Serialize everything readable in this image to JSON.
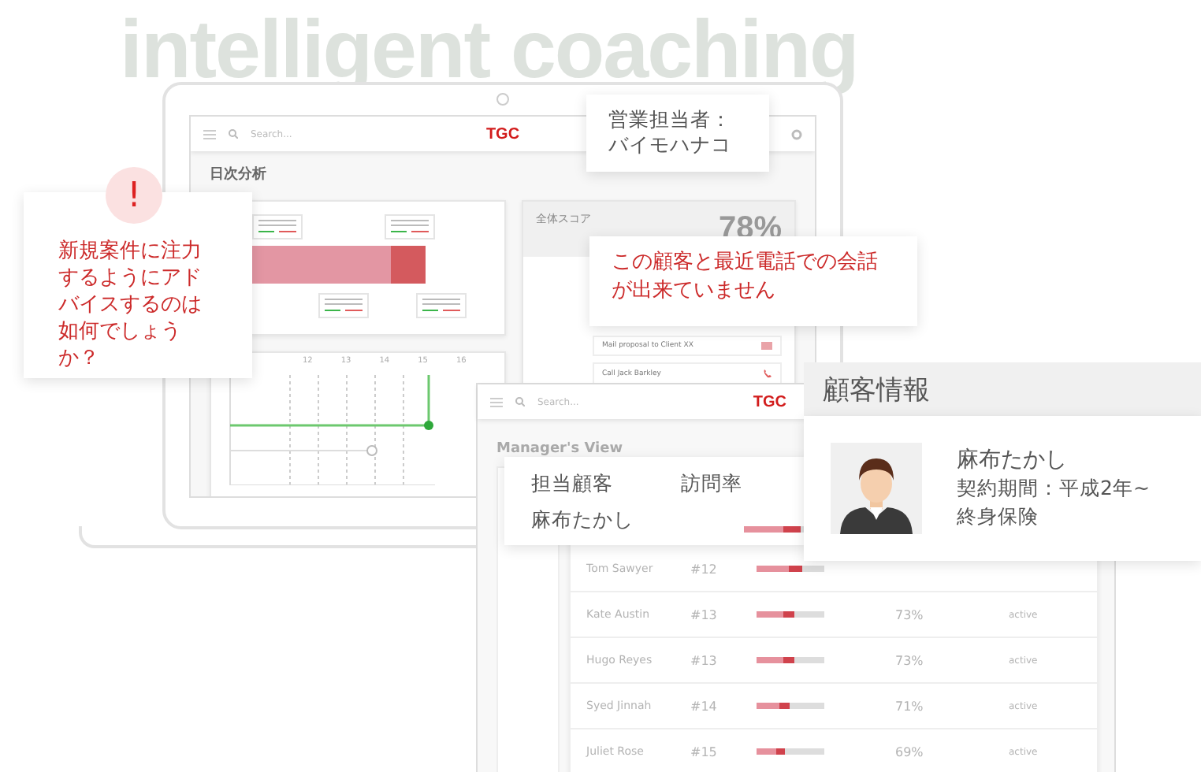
{
  "background_heading": "intelligent coaching",
  "laptop_app": {
    "search_placeholder": "Search...",
    "logo": "TGC",
    "page_title": "日次分析",
    "timeline_ticks": [
      "12",
      "13",
      "14",
      "15",
      "16"
    ],
    "score_card": {
      "title": "全体スコア",
      "value": "78%"
    },
    "tasks": [
      {
        "kind": "mail",
        "label": "Mail proposal to Client XX"
      },
      {
        "kind": "call",
        "label": "Call Jack Barkley"
      }
    ]
  },
  "rep_card": {
    "label": "営業担当者：",
    "name": "バイモハナコ"
  },
  "alert_card": {
    "icon": "!",
    "message": "新規案件に注力するようにアドバイスするのは如何でしょうか？"
  },
  "notice_card": {
    "message": "この顧客と最近電話での会話が出来ていません"
  },
  "manager_app": {
    "search_placeholder": "Search...",
    "logo": "TGC",
    "title": "Manager's View",
    "rows": [
      {
        "name": "Tom Sawyer",
        "number": "#12",
        "level": 0.68
      },
      {
        "name": "Kate Austin",
        "number": "#13",
        "level": 0.55,
        "rate": "73%",
        "status": "active"
      },
      {
        "name": "Hugo Reyes",
        "number": "#13",
        "level": 0.55,
        "rate": "73%",
        "status": "active"
      },
      {
        "name": "Syed Jinnah",
        "number": "#14",
        "level": 0.48,
        "rate": "71%",
        "status": "active"
      },
      {
        "name": "Juliet Rose",
        "number": "#15",
        "level": 0.42,
        "rate": "69%",
        "status": "active"
      }
    ]
  },
  "assigned_card": {
    "columns": [
      "担当顧客",
      "訪問率"
    ],
    "customer": "麻布たかし",
    "level": 0.9
  },
  "customer_info": {
    "title": "顧客情報",
    "name": "麻布たかし",
    "contract": "契約期間：平成2年~",
    "product": "終身保険"
  }
}
